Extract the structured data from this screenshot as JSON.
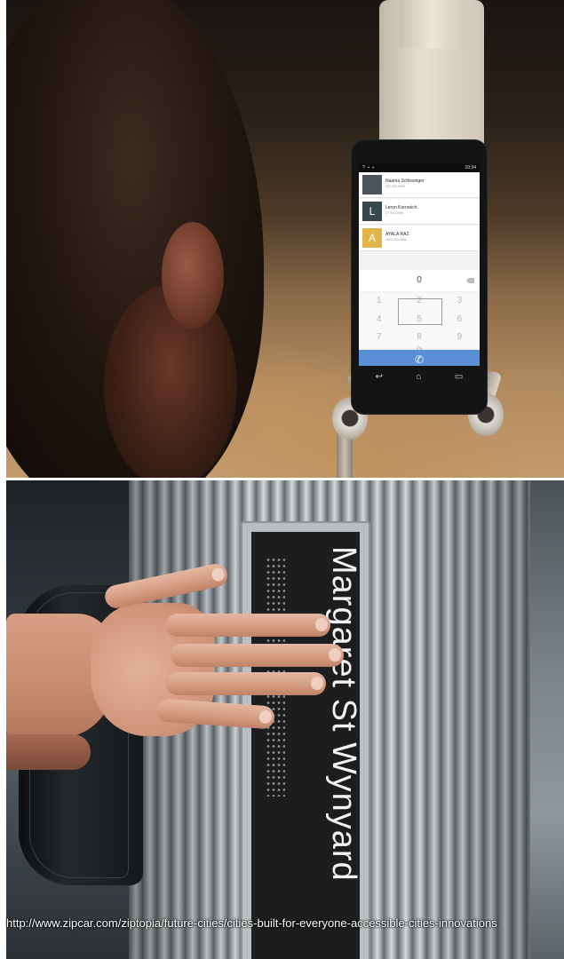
{
  "top_photo": {
    "phone": {
      "status_time": "10:34",
      "contacts": [
        {
          "initial": "",
          "name": "Naama Schlesinger",
          "number": "052-332-9656",
          "avatar_color": "#4a5560"
        },
        {
          "initial": "L",
          "name": "Leron Kornreich",
          "number": "07-332-9656",
          "avatar_color": "#37474f"
        },
        {
          "initial": "A",
          "name": "AYALA RAZ",
          "number": "0602-332-9656",
          "avatar_color": "#e0b64a"
        }
      ],
      "dialed_digits": "0",
      "keypad_keys": [
        "1",
        "2",
        "3",
        "4",
        "5",
        "6",
        "7",
        "8",
        "9"
      ],
      "call_bar_color": "#5a8fd6"
    }
  },
  "caption": {
    "text": "http://www.zipcar.com/ziptopia/future-cities/cities-built-for-everyone-accessible-cities-innovations"
  },
  "bottom_photo": {
    "sign_text": "Margaret St Wynyard"
  }
}
